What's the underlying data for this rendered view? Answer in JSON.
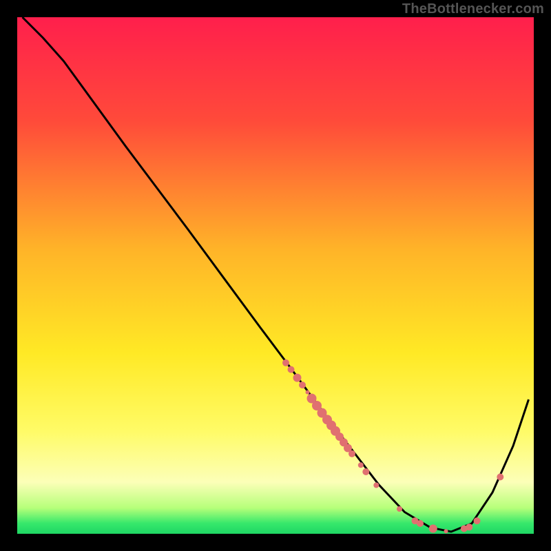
{
  "watermark": "TheBottlenecker.com",
  "gradient": {
    "stops": [
      {
        "offset": 0,
        "color": "#ff1f4c"
      },
      {
        "offset": 20,
        "color": "#ff4a3a"
      },
      {
        "offset": 45,
        "color": "#ffb428"
      },
      {
        "offset": 65,
        "color": "#ffe925"
      },
      {
        "offset": 80,
        "color": "#fffb66"
      },
      {
        "offset": 90,
        "color": "#fcffb8"
      },
      {
        "offset": 95,
        "color": "#b6ff7a"
      },
      {
        "offset": 98,
        "color": "#36e86b"
      },
      {
        "offset": 100,
        "color": "#1fd664"
      }
    ]
  },
  "chart_data": {
    "type": "line",
    "title": "",
    "xlabel": "",
    "ylabel": "",
    "xlim": [
      0,
      100
    ],
    "ylim": [
      0,
      100
    ],
    "series": [
      {
        "name": "curve",
        "x": [
          1,
          5,
          9,
          13,
          17,
          21,
          27,
          33,
          40,
          47,
          53,
          60,
          65,
          70,
          75,
          80,
          84,
          88,
          92,
          96,
          99
        ],
        "y": [
          100,
          96,
          91.5,
          86,
          80.5,
          75,
          67,
          59,
          49.5,
          40,
          32,
          22.5,
          16,
          9.5,
          4.2,
          1.2,
          0.4,
          2.0,
          8.0,
          17.0,
          26.0
        ]
      }
    ],
    "markers": [
      {
        "x": 52.0,
        "y": 33.1,
        "r": 5
      },
      {
        "x": 53.0,
        "y": 31.8,
        "r": 5
      },
      {
        "x": 54.2,
        "y": 30.2,
        "r": 6
      },
      {
        "x": 55.2,
        "y": 28.8,
        "r": 5
      },
      {
        "x": 56.2,
        "y": 27.4,
        "r": 3
      },
      {
        "x": 57.0,
        "y": 26.2,
        "r": 7
      },
      {
        "x": 58.0,
        "y": 24.8,
        "r": 7
      },
      {
        "x": 59.0,
        "y": 23.4,
        "r": 7
      },
      {
        "x": 60.0,
        "y": 22.1,
        "r": 7
      },
      {
        "x": 60.8,
        "y": 21.0,
        "r": 7
      },
      {
        "x": 61.6,
        "y": 19.9,
        "r": 7
      },
      {
        "x": 62.4,
        "y": 18.8,
        "r": 6
      },
      {
        "x": 63.2,
        "y": 17.7,
        "r": 6
      },
      {
        "x": 64.0,
        "y": 16.6,
        "r": 6
      },
      {
        "x": 64.8,
        "y": 15.5,
        "r": 5
      },
      {
        "x": 66.5,
        "y": 13.3,
        "r": 4
      },
      {
        "x": 67.5,
        "y": 12.0,
        "r": 5
      },
      {
        "x": 69.5,
        "y": 9.4,
        "r": 4
      },
      {
        "x": 74.0,
        "y": 4.8,
        "r": 4
      },
      {
        "x": 77.0,
        "y": 2.5,
        "r": 5
      },
      {
        "x": 78.0,
        "y": 2.0,
        "r": 5
      },
      {
        "x": 80.5,
        "y": 1.0,
        "r": 6
      },
      {
        "x": 83.0,
        "y": 0.5,
        "r": 3
      },
      {
        "x": 86.5,
        "y": 1.0,
        "r": 5
      },
      {
        "x": 87.5,
        "y": 1.3,
        "r": 5
      },
      {
        "x": 89.0,
        "y": 2.5,
        "r": 5
      },
      {
        "x": 93.5,
        "y": 11.0,
        "r": 5
      }
    ]
  }
}
